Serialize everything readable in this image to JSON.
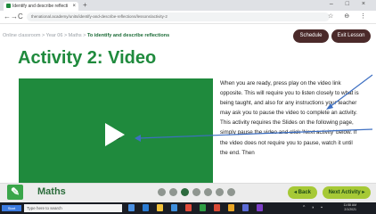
{
  "browser": {
    "tab_title": "Identify and describe reflecti",
    "tab_close": "×",
    "new_tab": "+",
    "window_controls": "– □ ×",
    "back": "←",
    "forward": "→",
    "reload": "C",
    "url": "thenational.academy/units/identify-and-describe-reflections/lessons/activity-2",
    "addr_icons": "☆ ⊖ ⋮"
  },
  "breadcrumb": {
    "prefix": "Online classroom > Year 06 > Maths > ",
    "current": "To identify and describe reflections"
  },
  "header_buttons": {
    "schedule": "Schedule",
    "exit_lesson": "Exit Lesson"
  },
  "title": "Activity 2: Video",
  "instructions": "When you are ready, press play on the video link opposite. This will require you to listen closely to what is being taught, and also for any instructions your teacher may ask you to pause the video to complete an activity. This activity requires the Slides on the following page, simply pause the video and click 'Next activity' below. If the video does not require you to pause, watch it until the end. Then",
  "footer": {
    "subject": "Maths",
    "progress": {
      "total": 7,
      "current": 3
    },
    "back": "◂ Back",
    "next": "Next Activity ▸"
  },
  "taskbar": {
    "start": "Start",
    "search_placeholder": "Type here to search",
    "time": "11:58 AM",
    "date": "2/1/2021"
  },
  "colors": {
    "brand_green": "#1f8a3d",
    "accent_lime": "#a6c936",
    "dark_button": "#4b2a2a",
    "arrow_blue": "#3d6fc2"
  }
}
